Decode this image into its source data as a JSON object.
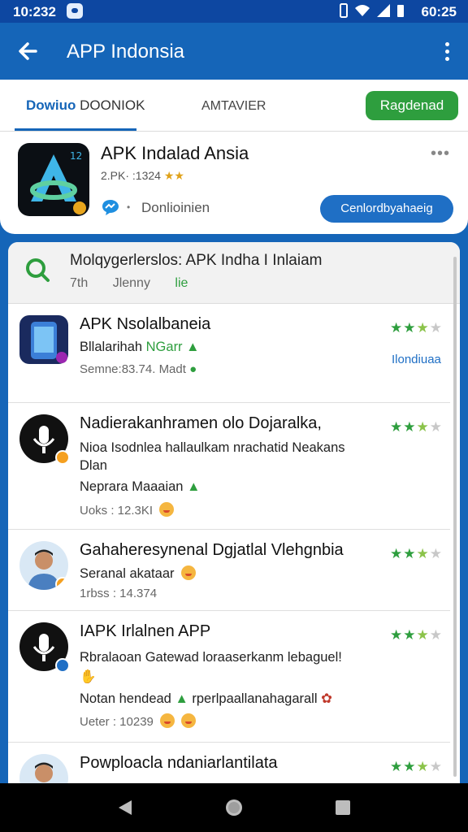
{
  "status_bar": {
    "time": "10:232",
    "battery": "60:25"
  },
  "app_bar": {
    "title": "APP Indonsia"
  },
  "tabs": {
    "tab1_prefix": "Dowiuo",
    "tab1_suffix": "DOONIOK",
    "tab2": "AMTAVIER",
    "action_button": "Ragdenad"
  },
  "featured": {
    "title": "APK Indalad Ansia",
    "meta": "2.PK· :1324",
    "rating_stars": "★★",
    "download_label": "Donlioinien",
    "cta": "Cenlordbyahaeig"
  },
  "search": {
    "line1": "Molqygerlerslos:  APK Indha I Inlaiam",
    "line2_a": "7th",
    "line2_b": "Jlenny",
    "line2_green": "lie"
  },
  "list": [
    {
      "title": "APK Nsolalbaneia",
      "line1": "Bllalarihah",
      "line1_green": "NGarr",
      "line2": "Semne:83.74. Madt",
      "rating": 2.5,
      "action": "Ilondiuaa"
    },
    {
      "title": "Nadierakanhramen olo Dojaralka,",
      "line1": "Nioa Isodnlea hallaulkam nrachatid Neakans",
      "line2": "Dlan",
      "line3": "Neprara Maaaian",
      "line4": "Uoks : 12.3KI",
      "rating": 2.5
    },
    {
      "title": "Gahaheresynenal  Dgjatlal Vlehgnbia",
      "line1": "Seranal akataar",
      "line2": "1rbss : 14.374",
      "rating": 2.5
    },
    {
      "title": "IAPK Irlalnen APP",
      "line1": "Rbralaoan Gatewad loraaserkanm lebaguel!",
      "line3": "Notan hendead",
      "line3_b": "rperlpaallanahagarall",
      "line4": "Ueter : 10239",
      "rating": 2.5
    },
    {
      "title": "Powploacla ndaniarlantilata",
      "rating": 2.5
    }
  ],
  "colors": {
    "primary": "#1565b8",
    "accent_green": "#2e9e3e",
    "cta_blue": "#1f6fc5"
  }
}
